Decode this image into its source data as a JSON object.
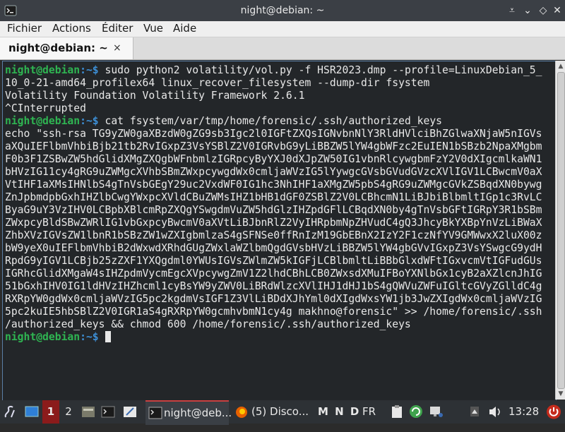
{
  "window": {
    "title": "night@debian: ~"
  },
  "menu": [
    "Fichier",
    "Actions",
    "Éditer",
    "Vue",
    "Aide"
  ],
  "tab": {
    "label": "night@debian: ~",
    "close": "×"
  },
  "terminal": {
    "prompt_user": "night@debian",
    "prompt_path": ":~$",
    "cmd1_lines": [
      " sudo python2 volatility/vol.py -f HSR2023.dmp --profile=LinuxDebian_5_",
      "10_0-21-amd64_profilex64 linux_recover_filesystem --dump-dir fsystem"
    ],
    "output": [
      "Volatility Foundation Volatility Framework 2.6.1",
      "^CInterrupted"
    ],
    "cmd2": " cat fsystem/var/tmp/home/forensic/.ssh/authorized_keys",
    "file_lines": [
      "echo \"ssh-rsa TG9yZW0gaXBzdW0gZG9sb3Igc2l0IGFtZXQsIGNvbnNlY3RldHVlciBhZGlwaXNjaW5nIGVs",
      "aXQuIEFlbmVhbiBjb21tb2RvIGxpZ3VsYSBlZ2V0IGRvbG9yLiBBZW5lYW4gbWFzc2EuIEN1bSBzb2NpaXMgbm",
      "F0b3F1ZSBwZW5hdGlidXMgZXQgbWFnbmlzIGRpcyByYXJ0dXJpZW50IG1vbnRlcywgbmFzY2V0dXIgcmlkaWN1",
      "bHVzIG11cy4gRG9uZWMgcXVhbSBmZWxpcywgdWx0cmljaWVzIG5lYywgcGVsbGVudGVzcXVlIGV1LCBwcmV0aX",
      "VtIHF1aXMsIHNlbS4gTnVsbGEgY29uc2VxdWF0IG1hc3NhIHF1aXMgZW5pbS4gRG9uZWMgcGVkZSBqdXN0bywg",
      "ZnJpbmdpbGxhIHZlbCwgYWxpcXVldCBuZWMsIHZ1bHB1dGF0ZSBlZ2V0LCBhcmN1LiBJbiBlbmltIGp1c3RvLC",
      "ByaG9uY3VzIHV0LCBpbXBlcmRpZXQgYSwgdmVuZW5hdGlzIHZpdGFlLCBqdXN0by4gTnVsbGFtIGRpY3R1bSBm",
      "ZWxpcyBldSBwZWRlIG1vbGxpcyBwcmV0aXVtLiBJbnRlZ2VyIHRpbmNpZHVudC4gQ3JhcyBkYXBpYnVzLiBWaX",
      "ZhbXVzIGVsZW1lbnR1bSBzZW1wZXIgbmlzaS4gSFNSe0ffRnIzM19GbEBnX2IzY2F1czNfYV9GMWwxX2luX00z",
      "bW9yeX0uIEFlbmVhbiB2dWxwdXRhdGUgZWxlaWZlbmQgdGVsbHVzLiBBZW5lYW4gbGVvIGxpZ3VsYSwgcG9ydH",
      "RpdG9yIGV1LCBjb25zZXF1YXQgdml0YWUsIGVsZWlmZW5kIGFjLCBlbmltLiBBbGlxdWFtIGxvcmVtIGFudGUs",
      "IGRhcGlidXMgaW4sIHZpdmVycmEgcXVpcywgZmV1Z2lhdCBhLCB0ZWxsdXMuIFBoYXNlbGx1cyB2aXZlcnJhIG",
      "51bGxhIHV0IG1ldHVzIHZhcml1cyBsYW9yZWV0LiBRdWlzcXVlIHJ1dHJ1bS4gQWVuZWFuIGltcGVyZGlldC4g",
      "RXRpYW0gdWx0cmljaWVzIG5pc2kgdmVsIGF1Z3VlLiBDdXJhYml0dXIgdWxsYW1jb3JwZXIgdWx0cmljaWVzIG",
      "5pc2kuIE5hbSBlZ2V0IGR1aS4gRXRpYW0gcmhvbmN1cy4g makhno@forensic\" >> /home/forensic/.ssh",
      "/authorized_keys && chmod 600 /home/forensic/.ssh/authorized_keys"
    ]
  },
  "taskbar": {
    "workspaces": [
      "1",
      "2"
    ],
    "tasks": [
      "night@deb...",
      "(5) Disco..."
    ],
    "indicators": "M N D",
    "layout": "FR",
    "clock": "13:28"
  },
  "colors": {
    "prompt_user": "#2fb552",
    "prompt_path": "#3d8fd6",
    "terminal_bg": "#232629"
  }
}
